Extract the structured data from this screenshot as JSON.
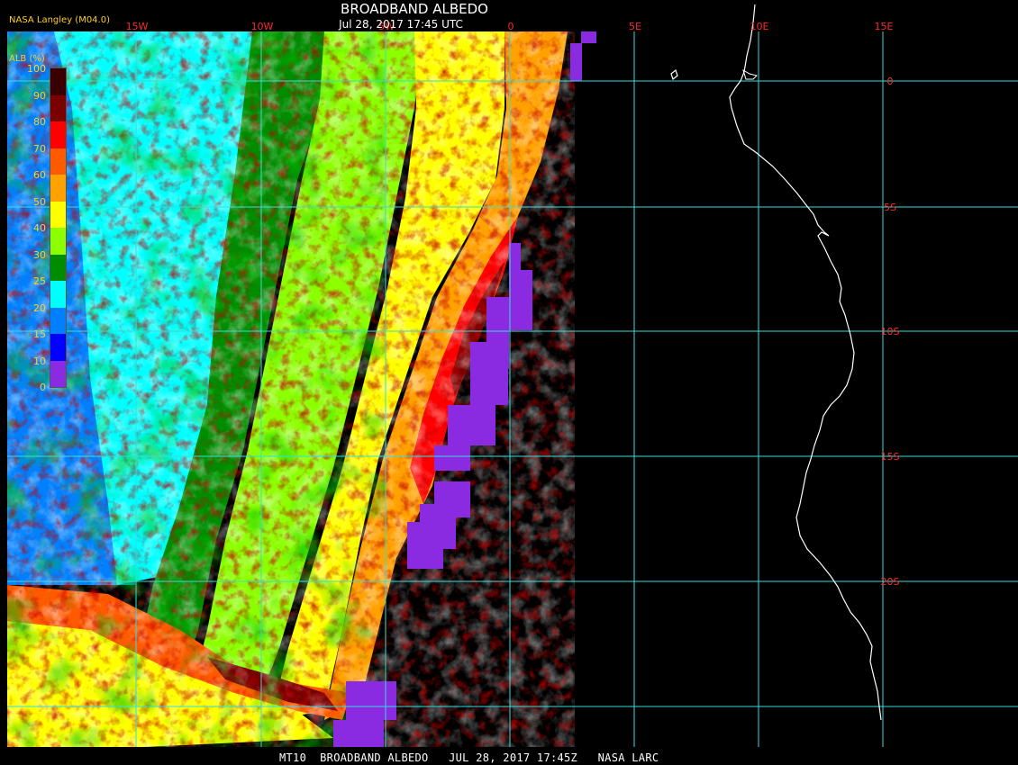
{
  "header": {
    "title": "BROADBAND ALBEDO",
    "timestamp": "Jul 28, 2017 17:45 UTC",
    "credit": "NASA Langley (M04.0)"
  },
  "footer": {
    "caption": "MT10  BROADBAND ALBEDO   JUL 28, 2017 17:45Z   NASA LARC"
  },
  "map": {
    "graticule_color": "#33dddd",
    "label_color": "#ff2a2a",
    "longitude_labels": [
      "15W",
      "10W",
      "5W",
      "0",
      "5E",
      "10E",
      "15E"
    ],
    "latitude_labels": [
      "0",
      "5S",
      "10S",
      "15S",
      "20S"
    ],
    "coastline_color": "#ffffff",
    "no_data_color": "#000000"
  },
  "colorbar": {
    "title": "ALB (%)",
    "labels": [
      "100",
      "90",
      "80",
      "70",
      "60",
      "50",
      "40",
      "30",
      "25",
      "20",
      "15",
      "10",
      "0"
    ],
    "colors": [
      "#3a0000",
      "#7a0000",
      "#ff0000",
      "#ff5a00",
      "#ffa200",
      "#ffff00",
      "#8cff00",
      "#008c00",
      "#00ffff",
      "#0080ff",
      "#0000ff",
      "#8a2be2"
    ]
  }
}
